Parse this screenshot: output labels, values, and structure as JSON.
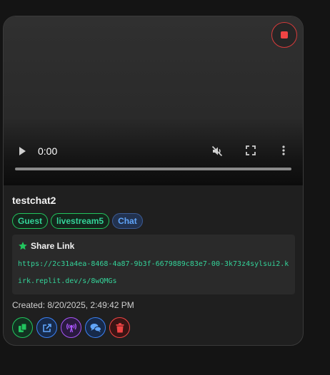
{
  "stream": {
    "name": "testchat2",
    "tags": [
      "Guest",
      "livestream5"
    ],
    "chat_label": "Chat"
  },
  "player": {
    "time": "0:00",
    "progress": 0,
    "icons": [
      "play-icon",
      "mute-icon",
      "fullscreen-icon",
      "more-icon"
    ]
  },
  "record_button": {
    "icon": "stop-icon",
    "color": "#ef4444"
  },
  "share": {
    "title": "Share Link",
    "url": "https://2c31a4ea-8468-4a87-9b3f-6679889c83e7-00-3k73z4sylsui2.kirk.replit.dev/s/8wQMGs"
  },
  "created": "Created: 8/20/2025, 2:49:42 PM",
  "actions": [
    {
      "icon": "copy-icon",
      "color": "#22c55e"
    },
    {
      "icon": "external-link-icon",
      "color": "#3b82f6"
    },
    {
      "icon": "broadcast-icon",
      "color": "#a855f7"
    },
    {
      "icon": "chat-icon",
      "color": "#3b82f6"
    },
    {
      "icon": "trash-icon",
      "color": "#ef4444"
    }
  ]
}
